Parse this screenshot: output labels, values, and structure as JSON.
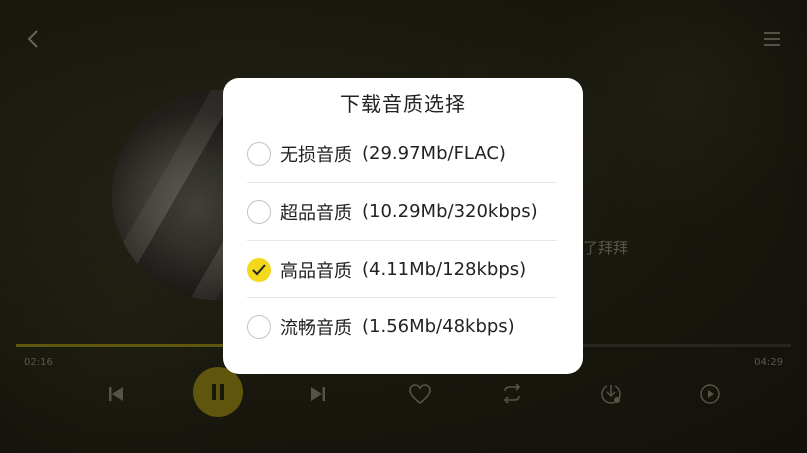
{
  "dialog": {
    "title": "下载音质选择",
    "options": [
      {
        "name": "无损音质",
        "detail": "(29.97Mb/FLAC)",
        "selected": false
      },
      {
        "name": "超品音质",
        "detail": "(10.29Mb/320kbps)",
        "selected": false
      },
      {
        "name": "高品音质",
        "detail": "(4.11Mb/128kbps)",
        "selected": true
      },
      {
        "name": "流畅音质",
        "detail": "(1.56Mb/48kbps)",
        "selected": false
      }
    ]
  },
  "player": {
    "lyric": "说了拜拜",
    "current_time": "02:16",
    "total_time": "04:29",
    "progress_fraction": 0.52
  },
  "colors": {
    "accent": "#f4d81b",
    "accent_dim": "#9b8a14"
  },
  "icons": {
    "back": "chevron-left-icon",
    "menu": "hamburger-menu-icon",
    "prev": "skip-previous-icon",
    "pause": "pause-icon",
    "next": "skip-next-icon",
    "like": "heart-icon",
    "repeat": "repeat-icon",
    "download": "download-icon",
    "video": "play-video-icon",
    "check": "check-icon"
  }
}
